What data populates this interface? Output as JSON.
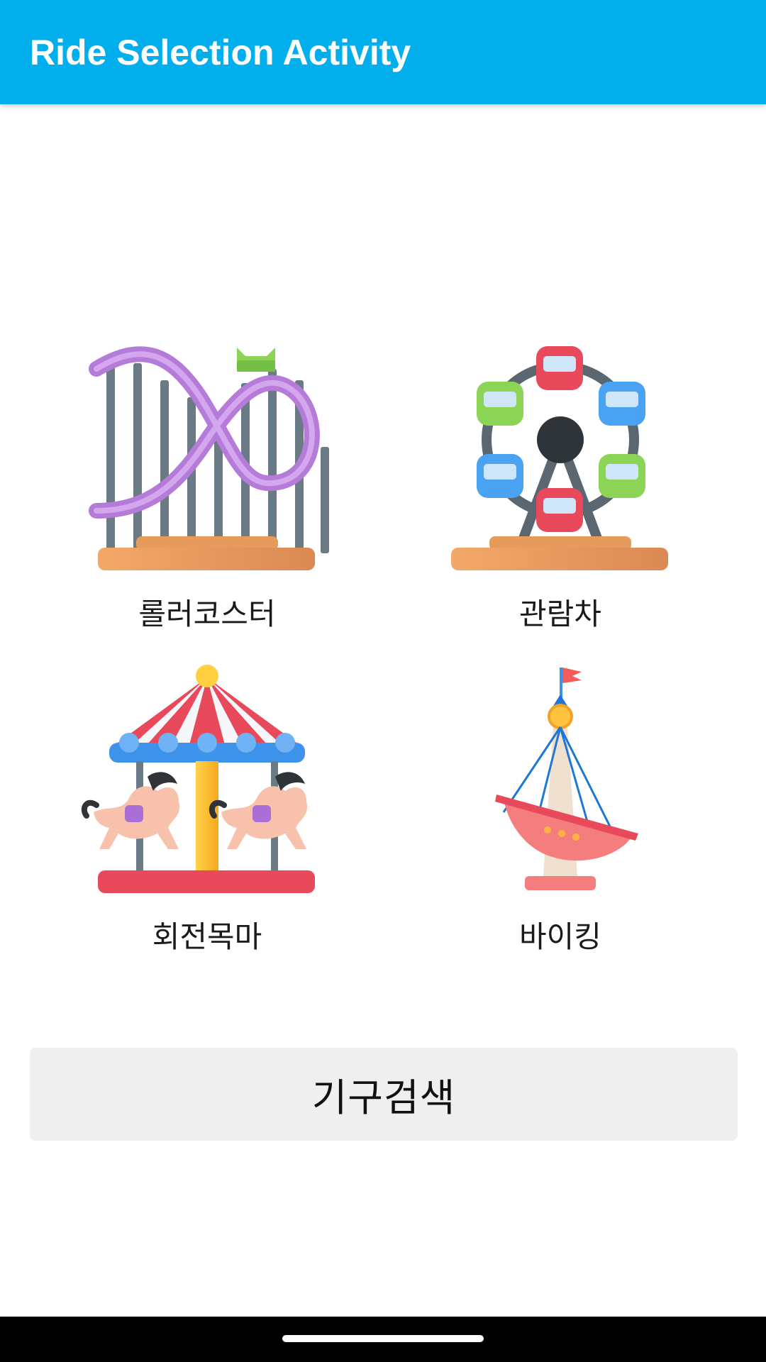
{
  "app": {
    "title": "Ride Selection Activity"
  },
  "rides": [
    {
      "label": "롤러코스터",
      "icon": "roller-coaster-icon"
    },
    {
      "label": "관람차",
      "icon": "ferris-wheel-icon"
    },
    {
      "label": "회전목마",
      "icon": "carousel-icon"
    },
    {
      "label": "바이킹",
      "icon": "pirate-ship-icon"
    }
  ],
  "search_button": {
    "label": "기구검색"
  },
  "colors": {
    "appbar": "#03aeec",
    "button_bg": "#efefef",
    "navbar": "#000000"
  }
}
